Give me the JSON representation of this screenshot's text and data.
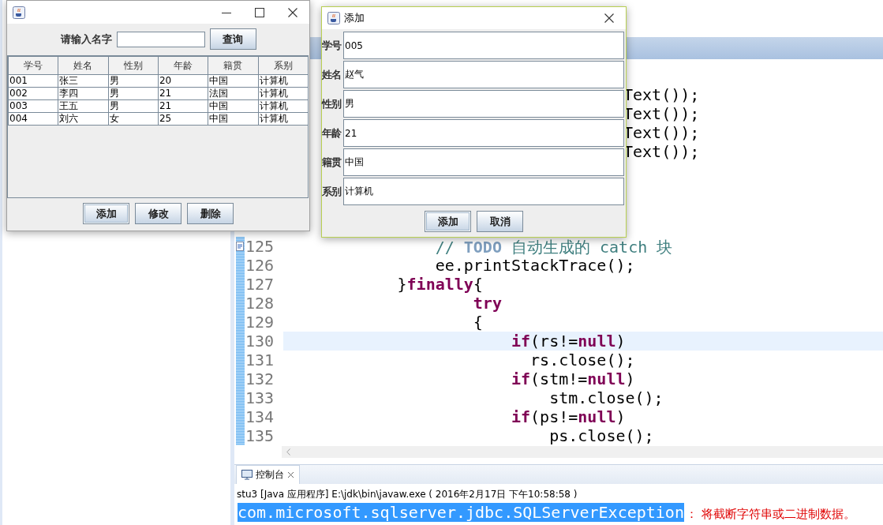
{
  "ide": {
    "editor": {
      "partial_lines": [
        {
          "code": "Text());"
        },
        {
          "code": "Text());"
        },
        {
          "code": "Text());"
        },
        {
          "code": "Text());"
        }
      ],
      "lines": [
        {
          "number": "125",
          "current": false,
          "task_marker": true,
          "tokens": [
            {
              "kind": "comment",
              "text": "                // "
            },
            {
              "kind": "task",
              "text": "TODO"
            },
            {
              "kind": "comment",
              "text": " 自动生成的 catch 块"
            }
          ]
        },
        {
          "number": "126",
          "current": false,
          "task_marker": false,
          "tokens": [
            {
              "kind": "plain",
              "text": "                ee.printStackTrace();"
            }
          ]
        },
        {
          "number": "127",
          "current": false,
          "task_marker": false,
          "tokens": [
            {
              "kind": "plain",
              "text": "            }"
            },
            {
              "kind": "keyword",
              "text": "finally"
            },
            {
              "kind": "plain",
              "text": "{"
            }
          ]
        },
        {
          "number": "128",
          "current": false,
          "task_marker": false,
          "tokens": [
            {
              "kind": "keyword",
              "text": "                    try"
            }
          ]
        },
        {
          "number": "129",
          "current": false,
          "task_marker": false,
          "tokens": [
            {
              "kind": "plain",
              "text": "                    {"
            }
          ]
        },
        {
          "number": "130",
          "current": true,
          "task_marker": false,
          "tokens": [
            {
              "kind": "keyword",
              "text": "                        if"
            },
            {
              "kind": "plain",
              "text": "(rs!="
            },
            {
              "kind": "keyword",
              "text": "null"
            },
            {
              "kind": "plain",
              "text": ")"
            }
          ]
        },
        {
          "number": "131",
          "current": false,
          "task_marker": false,
          "tokens": [
            {
              "kind": "plain",
              "text": "                          rs.close();"
            }
          ]
        },
        {
          "number": "132",
          "current": false,
          "task_marker": false,
          "tokens": [
            {
              "kind": "keyword",
              "text": "                        if"
            },
            {
              "kind": "plain",
              "text": "(stm!="
            },
            {
              "kind": "keyword",
              "text": "null"
            },
            {
              "kind": "plain",
              "text": ")"
            }
          ]
        },
        {
          "number": "133",
          "current": false,
          "task_marker": false,
          "tokens": [
            {
              "kind": "plain",
              "text": "                            stm.close();"
            }
          ]
        },
        {
          "number": "134",
          "current": false,
          "task_marker": false,
          "tokens": [
            {
              "kind": "keyword",
              "text": "                        if"
            },
            {
              "kind": "plain",
              "text": "(ps!="
            },
            {
              "kind": "keyword",
              "text": "null"
            },
            {
              "kind": "plain",
              "text": ")"
            }
          ]
        },
        {
          "number": "135",
          "current": false,
          "task_marker": false,
          "tokens": [
            {
              "kind": "plain",
              "text": "                            ps.close();"
            }
          ]
        }
      ]
    },
    "console": {
      "tab": {
        "label": "控制台"
      },
      "header": "stu3 [Java 应用程序] E:\\jdk\\bin\\javaw.exe ( 2016年2月17日 下午10:58:58 )",
      "output": [
        {
          "text": "com.microsoft.sqlserver.jdbc.SQLServerException",
          "selected": true
        },
        {
          "text": "： 将截断字符串或二进制数据。",
          "selected": false
        }
      ]
    }
  },
  "student_window": {
    "search": {
      "label": "请输入名字",
      "button": {
        "label": "查询",
        "focused": false
      }
    },
    "table": {
      "columns": [
        "学号",
        "姓名",
        "性别",
        "年龄",
        "籍贯",
        "系别"
      ],
      "rows": [
        [
          "001",
          "张三",
          "男",
          "20",
          "中国",
          "计算机"
        ],
        [
          "002",
          "李四",
          "男",
          "21",
          "法国",
          "计算机"
        ],
        [
          "003",
          "王五",
          "男",
          "21",
          "中国",
          "计算机"
        ],
        [
          "004",
          "刘六",
          "女",
          "25",
          "中国",
          "计算机"
        ]
      ]
    },
    "buttons": [
      {
        "label": "添加",
        "focused": true
      },
      {
        "label": "修改",
        "focused": false
      },
      {
        "label": "删除",
        "focused": false
      }
    ]
  },
  "add_dialog": {
    "title": "添加",
    "fields": [
      {
        "label": "学号",
        "value": "005"
      },
      {
        "label": "姓名",
        "value": "赵气"
      },
      {
        "label": "性别",
        "value": "男"
      },
      {
        "label": "年龄",
        "value": "21"
      },
      {
        "label": "籍贯",
        "value": "中国"
      },
      {
        "label": "系别",
        "value": "计算机"
      }
    ],
    "buttons": [
      {
        "label": "添加",
        "focused": true
      },
      {
        "label": "取消",
        "focused": false
      }
    ]
  }
}
